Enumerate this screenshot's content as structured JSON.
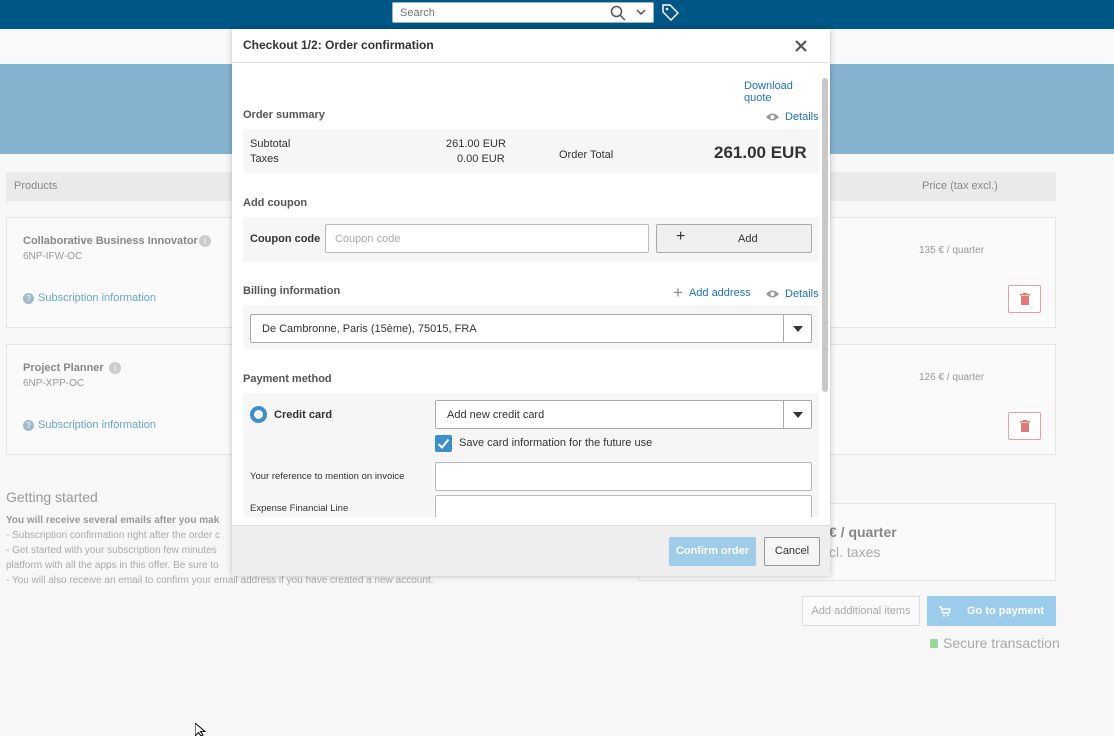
{
  "topbar": {
    "search_placeholder": "Search",
    "icons": [
      "search-icon",
      "chevron-down-icon",
      "tag-icon"
    ]
  },
  "background": {
    "table_header": {
      "products": "Products",
      "price": "Price (tax excl.)"
    },
    "products": [
      {
        "name": "Collaborative Business Innovator",
        "sku": "6NP-IFW-OC",
        "subscription_link": "Subscription information",
        "price": "135 € / quarter"
      },
      {
        "name": "Project Planner",
        "sku": "6NP-XPP-OC",
        "subscription_link": "Subscription information",
        "price": "126 € / quarter"
      }
    ],
    "getting_started": {
      "title": "Getting started",
      "lines": [
        "You will receive several emails after you mak",
        "- Subscription confirmation right after the order c",
        "- Get started with your subscription few minutes",
        "platform with all the apps in this offer. Be sure to",
        "- You will also receive an email to confirm your email address if you have created a new account."
      ]
    },
    "total_box": {
      "line1": "€ / quarter",
      "line2": "cl. taxes"
    },
    "add_items_label": "Add additional items",
    "go_to_payment_label": "Go to payment",
    "secure_label": "Secure transaction"
  },
  "modal": {
    "title": "Checkout 1/2: Order confirmation",
    "download_quote": "Download quote",
    "order_summary": {
      "title": "Order summary",
      "details_link": "Details",
      "subtotal_label": "Subtotal",
      "subtotal_value": "261.00 EUR",
      "taxes_label": "Taxes",
      "taxes_value": "0.00 EUR",
      "total_label": "Order Total",
      "total_value": "261.00 EUR"
    },
    "coupon": {
      "title": "Add coupon",
      "label": "Coupon code",
      "placeholder": "Coupon code",
      "add_label": "Add"
    },
    "billing": {
      "title": "Billing information",
      "add_address": "Add address",
      "details_link": "Details",
      "address": "De Cambronne, Paris (15ème), 75015, FRA"
    },
    "payment": {
      "title": "Payment method",
      "method_label": "Credit card",
      "card_select": "Add new credit card",
      "save_card_label": "Save card information for the future use",
      "save_card_checked": true,
      "reference_label": "Your reference to mention on invoice",
      "reference_value": "",
      "expense_label": "Expense Financial Line",
      "expense_value": ""
    },
    "footer": {
      "confirm_label": "Confirm order",
      "cancel_label": "Cancel"
    }
  },
  "colors": {
    "topbar": "#005686",
    "link": "#1f73b7",
    "confirm": "#9fcde9",
    "checkbox": "#3d8fc9"
  }
}
